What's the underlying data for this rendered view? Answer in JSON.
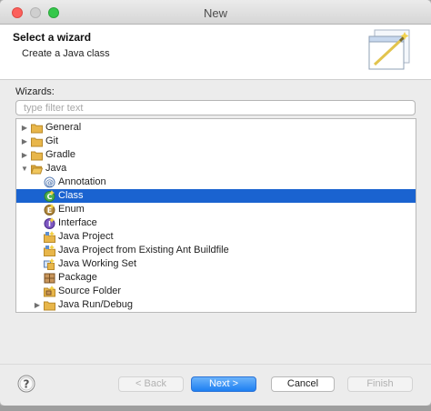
{
  "window": {
    "title": "New"
  },
  "header": {
    "title": "Select a wizard",
    "subtitle": "Create a Java class"
  },
  "wizards": {
    "label": "Wizards:",
    "filter_placeholder": "type filter text",
    "items": [
      {
        "label": "General",
        "icon": "folder-icon",
        "twisty": "collapsed"
      },
      {
        "label": "Git",
        "icon": "folder-icon",
        "twisty": "collapsed"
      },
      {
        "label": "Gradle",
        "icon": "folder-icon",
        "twisty": "collapsed"
      },
      {
        "label": "Java",
        "icon": "folder-open-icon",
        "twisty": "expanded"
      },
      {
        "label": "Annotation",
        "icon": "annotation-icon"
      },
      {
        "label": "Class",
        "icon": "class-icon",
        "selected": true
      },
      {
        "label": "Enum",
        "icon": "enum-icon"
      },
      {
        "label": "Interface",
        "icon": "interface-icon"
      },
      {
        "label": "Java Project",
        "icon": "java-project-icon"
      },
      {
        "label": "Java Project from Existing Ant Buildfile",
        "icon": "ant-project-icon"
      },
      {
        "label": "Java Working Set",
        "icon": "working-set-icon"
      },
      {
        "label": "Package",
        "icon": "package-icon"
      },
      {
        "label": "Source Folder",
        "icon": "source-folder-icon"
      },
      {
        "label": "Java Run/Debug",
        "icon": "folder-icon",
        "twisty": "collapsed"
      }
    ]
  },
  "buttons": {
    "back": "< Back",
    "next": "Next >",
    "cancel": "Cancel",
    "finish": "Finish"
  },
  "colors": {
    "selection": "#1a63d0",
    "default_button": "#1d7ff2",
    "folder": "#e8b64a"
  }
}
